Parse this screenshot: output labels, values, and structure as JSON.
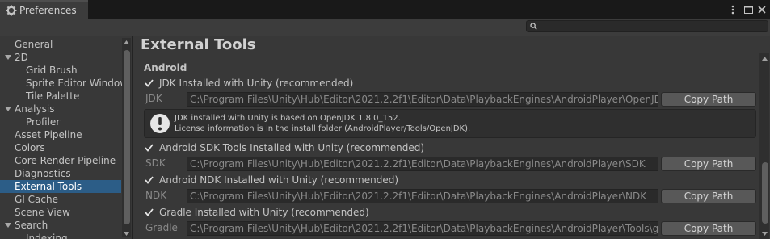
{
  "window": {
    "tab_title": "Preferences",
    "icons": {
      "settings": "gear-icon",
      "menu": "kebab-menu-icon",
      "maximize": "maximize-icon",
      "close": "close-icon"
    }
  },
  "search": {
    "placeholder": "",
    "icon": "search-icon"
  },
  "sidebar": {
    "items": [
      {
        "label": "General"
      },
      {
        "label": "2D"
      },
      {
        "label": "Grid Brush"
      },
      {
        "label": "Sprite Editor Window"
      },
      {
        "label": "Tile Palette"
      },
      {
        "label": "Analysis"
      },
      {
        "label": "Profiler"
      },
      {
        "label": "Asset Pipeline"
      },
      {
        "label": "Colors"
      },
      {
        "label": "Core Render Pipeline"
      },
      {
        "label": "Diagnostics"
      },
      {
        "label": "External Tools"
      },
      {
        "label": "GI Cache"
      },
      {
        "label": "Scene View"
      },
      {
        "label": "Search"
      },
      {
        "label": "Indexing"
      }
    ],
    "selected": "External Tools"
  },
  "main": {
    "title": "External Tools",
    "section": "Android",
    "copy_label": "Copy Path",
    "jdk": {
      "checkbox_label": "JDK Installed with Unity (recommended)",
      "field_label": "JDK",
      "path": "C:\\Program Files\\Unity\\Hub\\Editor\\2021.2.2f1\\Editor\\Data\\PlaybackEngines\\AndroidPlayer\\OpenJDK",
      "help_line1": "JDK installed with Unity is based on OpenJDK 1.8.0_152.",
      "help_line2": "License information is in the install folder (AndroidPlayer/Tools/OpenJDK)."
    },
    "sdk": {
      "checkbox_label": "Android SDK Tools Installed with Unity (recommended)",
      "field_label": "SDK",
      "path": "C:\\Program Files\\Unity\\Hub\\Editor\\2021.2.2f1\\Editor\\Data\\PlaybackEngines\\AndroidPlayer\\SDK"
    },
    "ndk": {
      "checkbox_label": "Android NDK Installed with Unity (recommended)",
      "field_label": "NDK",
      "path": "C:\\Program Files\\Unity\\Hub\\Editor\\2021.2.2f1\\Editor\\Data\\PlaybackEngines\\AndroidPlayer\\NDK"
    },
    "gradle": {
      "checkbox_label": "Gradle Installed with Unity (recommended)",
      "field_label": "Gradle",
      "path": "C:\\Program Files\\Unity\\Hub\\Editor\\2021.2.2f1\\Editor\\Data\\PlaybackEngines\\AndroidPlayer\\Tools\\gradle"
    }
  },
  "colors": {
    "accent": "#2c5d87",
    "background": "#383838",
    "titlebar": "#191919"
  }
}
